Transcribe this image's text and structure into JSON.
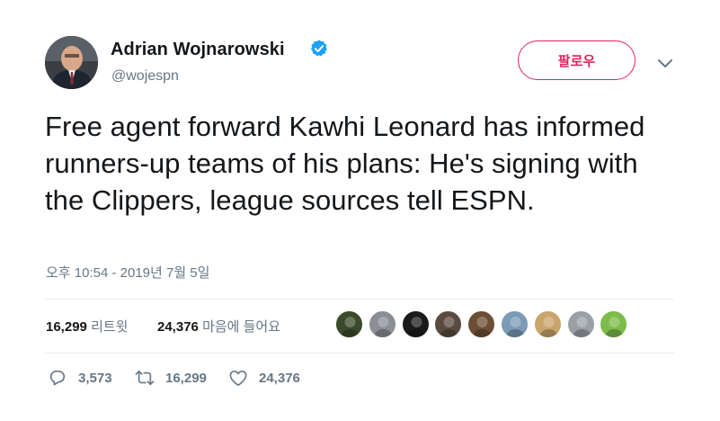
{
  "author": {
    "name": "Adrian Wojnarowski",
    "handle": "@wojespn",
    "verified_icon": "verified-badge-icon",
    "verified_color": "#1da1f2"
  },
  "follow_button": {
    "label": "팔로우",
    "color": "#e0245e"
  },
  "menu": {
    "icon": "chevron-down-icon"
  },
  "tweet": {
    "text": "Free agent forward Kawhi Leonard has informed runners-up teams of his plans: He's signing with the Clippers, league sources tell ESPN.",
    "timestamp": "오후 10:54 - 2019년 7월 5일"
  },
  "stats": {
    "retweets_count": "16,299",
    "retweets_label": "리트윗",
    "likes_count": "24,376",
    "likes_label": "마음에 들어요"
  },
  "liker_avatars": [
    {
      "name": "liker-avatar-1",
      "color": "#3a4a2a"
    },
    {
      "name": "liker-avatar-2",
      "color": "#8a8f96"
    },
    {
      "name": "liker-avatar-3",
      "color": "#1b1b1b"
    },
    {
      "name": "liker-avatar-4",
      "color": "#5a4a3f"
    },
    {
      "name": "liker-avatar-5",
      "color": "#6b4e35"
    },
    {
      "name": "liker-avatar-6",
      "color": "#7a9ab5"
    },
    {
      "name": "liker-avatar-7",
      "color": "#c9a56b"
    },
    {
      "name": "liker-avatar-8",
      "color": "#9aa0a6"
    },
    {
      "name": "liker-avatar-9",
      "color": "#7dbb4a"
    }
  ],
  "actions": {
    "reply_count": "3,573",
    "retweet_count": "16,299",
    "like_count": "24,376"
  },
  "colors": {
    "text_primary": "#14171a",
    "text_secondary": "#657786",
    "divider": "#e6ecf0"
  }
}
